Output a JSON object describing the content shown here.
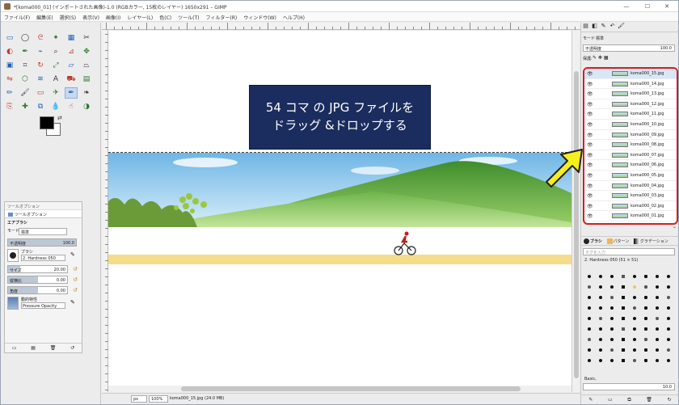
{
  "window": {
    "title": "*[koma000_01] (インポートされた画像)-1.0 (RGBカラー, 15枚のレイヤー) 1650x291 – GIMP",
    "minimize": "—",
    "maximize": "☐",
    "close": "✕"
  },
  "menu": [
    "ファイル(F)",
    "編集(E)",
    "選択(S)",
    "表示(V)",
    "画像(I)",
    "レイヤー(L)",
    "色(C)",
    "ツール(T)",
    "フィルター(R)",
    "ウィンドウ(W)",
    "ヘルプ(H)"
  ],
  "toolbox": {
    "tools": [
      "rect-select",
      "ellipse-select",
      "free-select",
      "fuzzy-select",
      "by-color-select",
      "scissors-select",
      "foreground-select",
      "paths",
      "color-picker",
      "zoom",
      "measure",
      "move",
      "align",
      "crop",
      "rotate",
      "scale",
      "shear",
      "perspective",
      "flip",
      "cage",
      "warp",
      "text",
      "bucket-fill",
      "blend",
      "pencil",
      "paintbrush",
      "eraser",
      "airbrush",
      "ink",
      "mypaint",
      "clone",
      "heal",
      "perspective-clone",
      "blur",
      "smudge",
      "dodge-burn"
    ],
    "active_tool_index": 28,
    "colors": {
      "fg": "#000000",
      "bg": "#ffffff"
    }
  },
  "tool_options": {
    "panel_title": "ツールオプション",
    "tab_label": "ツールオプション",
    "tool_name": "エアブラシ",
    "mode_label": "モード",
    "mode_value": "標準",
    "opacity_label": "不透明度",
    "opacity_value": "100.0",
    "brush_label": "ブラシ",
    "brush_value": "2. Hardness 050",
    "size_label": "サイズ",
    "size_value": "20.00",
    "aspect_label": "縦横比",
    "aspect_value": "0.00",
    "angle_label": "角度",
    "angle_value": "0.00",
    "dynamics_label": "動的特性",
    "dynamics_value": "Pressure Opacity"
  },
  "canvas": {
    "annotation_line1": "54 コマ の JPG ファイルを",
    "annotation_line2": "ドラッグ &ドロップする"
  },
  "statusbar": {
    "unit": "px",
    "zoom": "100%",
    "message": "koma000_15.jpg (24.0 MB)"
  },
  "layers_panel": {
    "mode_label": "モード",
    "mode_value": "標準",
    "opacity_label": "不透明度",
    "opacity_value": "100.0",
    "lock_label": "保護:",
    "layers": [
      "koma000_15.jpg",
      "koma000_14.jpg",
      "koma000_13.jpg",
      "koma000_12.jpg",
      "koma000_11.jpg",
      "koma000_10.jpg",
      "koma000_09.jpg",
      "koma000_08.jpg",
      "koma000_07.jpg",
      "koma000_06.jpg",
      "koma000_05.jpg",
      "koma000_04.jpg",
      "koma000_03.jpg",
      "koma000_02.jpg",
      "koma000_01.jpg"
    ],
    "highlight_color": "#d21e1e"
  },
  "brushes_panel": {
    "tab_brushes": "ブラシ",
    "tab_patterns": "パターン",
    "tab_gradients": "グラデーション",
    "filter_placeholder": "タグを入力",
    "current_brush": "2. Hardness 050 (51 × 51)",
    "preset_label": "Basic,",
    "spacing_value": "10.0"
  }
}
